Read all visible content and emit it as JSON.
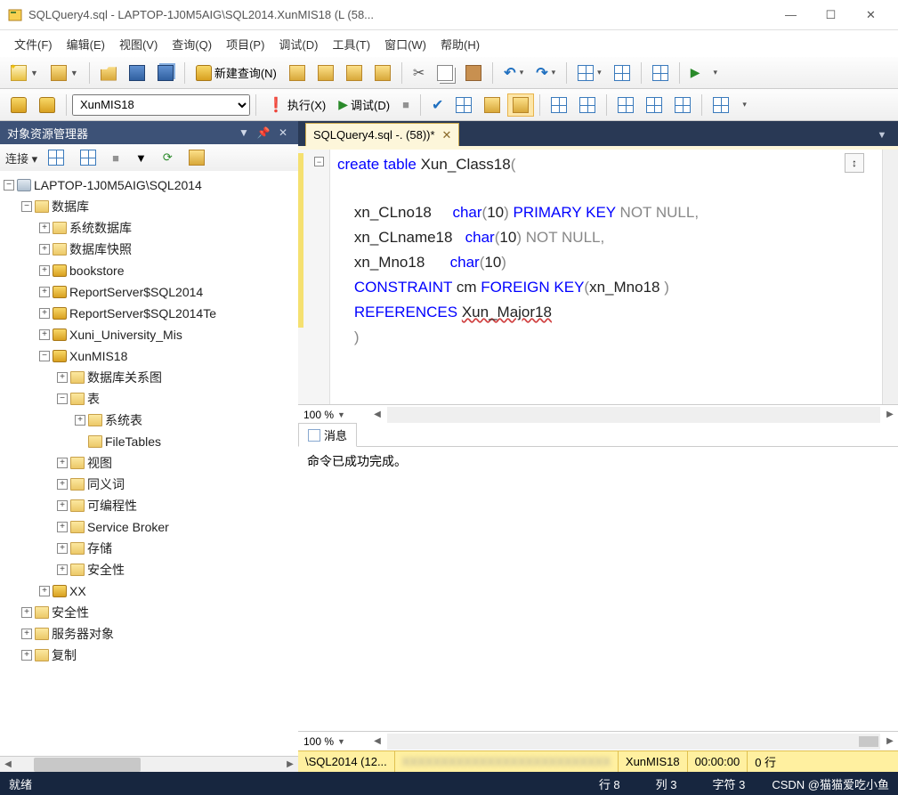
{
  "window": {
    "title": "SQLQuery4.sql - LAPTOP-1J0M5AIG\\SQL2014.XunMIS18 (L                               (58..."
  },
  "menu": [
    "文件(F)",
    "编辑(E)",
    "视图(V)",
    "查询(Q)",
    "项目(P)",
    "调试(D)",
    "工具(T)",
    "窗口(W)",
    "帮助(H)"
  ],
  "toolbar1": {
    "new_query_label": "新建查询(N)"
  },
  "toolbar2": {
    "database_selected": "XunMIS18",
    "execute_label": "执行(X)",
    "debug_label": "调试(D)"
  },
  "objexp": {
    "title": "对象资源管理器",
    "connect_label": "连接 ▾",
    "tree": {
      "server": "LAPTOP-1J0M5AIG\\SQL2014",
      "databases": "数据库",
      "sysdb": "系统数据库",
      "snapshot": "数据库快照",
      "db1": "bookstore",
      "db2": "ReportServer$SQL2014",
      "db3": "ReportServer$SQL2014Te",
      "db4": "Xuni_University_Mis",
      "db5": "XunMIS18",
      "diagram": "数据库关系图",
      "tables": "表",
      "systables": "系统表",
      "filetables": "FileTables",
      "views": "视图",
      "synonyms": "同义词",
      "programmability": "可编程性",
      "servicebroker": "Service Broker",
      "storage": "存储",
      "security_db": "安全性",
      "db6": "XX",
      "security": "安全性",
      "serverobjects": "服务器对象",
      "repl": "复制"
    }
  },
  "tab": {
    "label": "SQLQuery4.sql -.                       (58))*"
  },
  "editor": {
    "zoom": "100 %",
    "code": {
      "l1a": "create",
      "l1b": " table",
      "l1c": " Xun_Class18",
      "l1d": "(",
      "l3a": "    xn_CLno18     ",
      "l3b": "char",
      "l3c": "(",
      "l3d": "10",
      "l3e": ")",
      "l3f": " PRIMARY",
      " l3g": " KEY",
      "l3h": " NOT",
      " l3i": " NULL",
      "l3j": ",",
      "l4a": "    xn_CLname18   ",
      "l4b": "char",
      "l4c": "(",
      "l4d": "10",
      "l4e": ")",
      "l4f": " NOT",
      " l4g": " NULL",
      "l4h": ",",
      "l5a": "    xn_Mno18      ",
      "l5b": "char",
      "l5c": "(",
      "l5d": "10",
      "l5e": ")",
      "l6a": "    ",
      "l6b": "CONSTRAINT",
      "l6c": " cm ",
      "l6d": "FOREIGN",
      " l6e": " KEY",
      "l6f": "(",
      "l6g": "xn_Mno18 ",
      "l6h": ")",
      "l7a": "    ",
      "l7b": "REFERENCES",
      "l7c": " ",
      "l7d": "Xun_Major18",
      "l8a": "    )"
    }
  },
  "messages": {
    "tab_label": "消息",
    "text": "命令已成功完成。",
    "zoom": "100 %"
  },
  "connbar": {
    "server": "\\SQL2014 (12...",
    "db": "XunMIS18",
    "elapsed": "00:00:00",
    "rows": "0 行"
  },
  "statusbar": {
    "ready": "就绪",
    "line": "行 8",
    "col": "列 3",
    "char": "字符 3",
    "watermark": "CSDN @猫猫爱吃小鱼"
  }
}
